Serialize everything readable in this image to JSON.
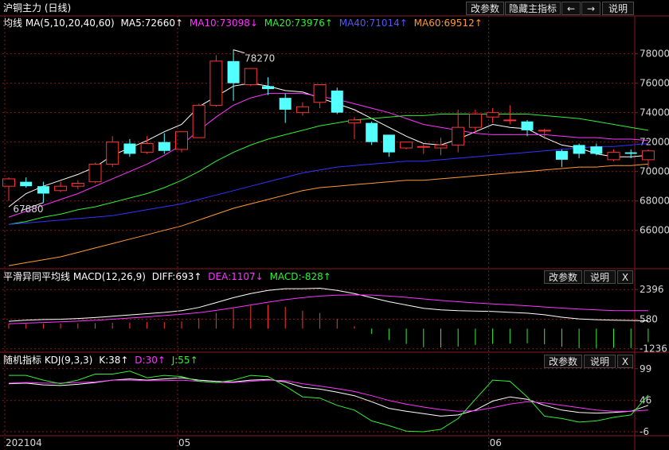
{
  "header": {
    "title": "沪铜主力 (日线)",
    "buttons": [
      "改参数",
      "隐藏主指标",
      "←",
      "→",
      "说明"
    ]
  },
  "main_legend": {
    "ma_title": "均线 MA(5,10,20,40,60)",
    "ma5": "MA5:72660↑",
    "ma10": "MA10:73098↓",
    "ma20": "MA20:73976↑",
    "ma40": "MA40:71014↑",
    "ma60": "MA60:69512↑"
  },
  "macd_panel": {
    "title": "平滑异同平均线 MACD(12,26,9)",
    "diff": "DIFF:693↑",
    "dea": "DEA:1107↓",
    "macd": "MACD:-828↑",
    "buttons": [
      "改参数",
      "说明",
      "X"
    ]
  },
  "kdj_panel": {
    "title": "随机指标 KDJ(9,3,3)",
    "k": "K:38↑",
    "d": "D:30↑",
    "j": "J:55↑",
    "buttons": [
      "改参数",
      "说明",
      "X"
    ]
  },
  "colors": {
    "up": "#ff3232",
    "down": "#54ffff",
    "ma5": "#ffffff",
    "ma10": "#ff33ff",
    "ma20": "#33ee33",
    "ma40": "#3333ff",
    "ma60": "#ff9933"
  },
  "chart_data": [
    {
      "type": "candlestick",
      "title": "沪铜主力 (日线)",
      "y_ticks": [
        66000,
        68000,
        70000,
        72000,
        74000,
        76000,
        78000
      ],
      "ylim": [
        63500,
        79600
      ],
      "x_labels": [
        "202104",
        "05",
        "06"
      ],
      "annotations": {
        "high": "78270",
        "low": "67880"
      },
      "candles": [
        {
          "o": 69000,
          "h": 69600,
          "l": 68000,
          "c": 69500
        },
        {
          "o": 69300,
          "h": 69600,
          "l": 68900,
          "c": 69000
        },
        {
          "o": 69000,
          "h": 69300,
          "l": 67880,
          "c": 68500
        },
        {
          "o": 68700,
          "h": 69300,
          "l": 68600,
          "c": 69000
        },
        {
          "o": 69000,
          "h": 69400,
          "l": 68800,
          "c": 69200
        },
        {
          "o": 69300,
          "h": 70600,
          "l": 69200,
          "c": 70500
        },
        {
          "o": 70500,
          "h": 72400,
          "l": 70300,
          "c": 72000
        },
        {
          "o": 71900,
          "h": 72200,
          "l": 71000,
          "c": 71200
        },
        {
          "o": 71300,
          "h": 72400,
          "l": 71200,
          "c": 71900
        },
        {
          "o": 72000,
          "h": 72600,
          "l": 71200,
          "c": 71400
        },
        {
          "o": 71500,
          "h": 72700,
          "l": 71300,
          "c": 72700
        },
        {
          "o": 72300,
          "h": 74600,
          "l": 72300,
          "c": 74500
        },
        {
          "o": 74500,
          "h": 77900,
          "l": 74400,
          "c": 77500
        },
        {
          "o": 77500,
          "h": 78270,
          "l": 74800,
          "c": 76000
        },
        {
          "o": 75900,
          "h": 77000,
          "l": 75800,
          "c": 77000
        },
        {
          "o": 75800,
          "h": 76400,
          "l": 75200,
          "c": 75600
        },
        {
          "o": 75000,
          "h": 75300,
          "l": 73300,
          "c": 74200
        },
        {
          "o": 74000,
          "h": 74700,
          "l": 73800,
          "c": 74400
        },
        {
          "o": 74700,
          "h": 75900,
          "l": 74300,
          "c": 75900
        },
        {
          "o": 75500,
          "h": 75700,
          "l": 73900,
          "c": 74000
        },
        {
          "o": 73300,
          "h": 73700,
          "l": 72200,
          "c": 73500
        },
        {
          "o": 73300,
          "h": 73400,
          "l": 71800,
          "c": 72000
        },
        {
          "o": 72500,
          "h": 72500,
          "l": 71000,
          "c": 71300
        },
        {
          "o": 71600,
          "h": 71900,
          "l": 71500,
          "c": 72000
        },
        {
          "o": 71700,
          "h": 71900,
          "l": 71200,
          "c": 71700
        },
        {
          "o": 71600,
          "h": 72300,
          "l": 71100,
          "c": 71800
        },
        {
          "o": 71800,
          "h": 74200,
          "l": 71300,
          "c": 73000
        },
        {
          "o": 73000,
          "h": 74200,
          "l": 72600,
          "c": 73900
        },
        {
          "o": 73700,
          "h": 74300,
          "l": 73300,
          "c": 74000
        },
        {
          "o": 73500,
          "h": 74500,
          "l": 73200,
          "c": 73500
        },
        {
          "o": 73400,
          "h": 73500,
          "l": 72400,
          "c": 72800
        },
        {
          "o": 72800,
          "h": 72900,
          "l": 72200,
          "c": 72800
        },
        {
          "o": 71400,
          "h": 71500,
          "l": 70300,
          "c": 70800
        },
        {
          "o": 71800,
          "h": 71900,
          "l": 70900,
          "c": 71200
        },
        {
          "o": 71700,
          "h": 71900,
          "l": 71100,
          "c": 71200
        },
        {
          "o": 70800,
          "h": 71500,
          "l": 70700,
          "c": 71300
        },
        {
          "o": 71300,
          "h": 71500,
          "l": 70900,
          "c": 71200
        },
        {
          "o": 70800,
          "h": 71500,
          "l": 70300,
          "c": 71400
        }
      ],
      "ma_series": [
        {
          "name": "MA5",
          "values": [
            67600,
            68500,
            69000,
            69400,
            69800,
            70300,
            71100,
            71600,
            72100,
            72700,
            73200,
            74400,
            75100,
            75800,
            76000,
            75800,
            75500,
            75400,
            75000,
            74600,
            74200,
            73600,
            73000,
            72400,
            71900,
            71800,
            72200,
            72700,
            73200,
            73000,
            72900,
            72300,
            71800,
            71600,
            71200,
            71000,
            71000,
            71100
          ]
        },
        {
          "name": "MA10",
          "values": [
            66900,
            67300,
            67700,
            68100,
            68500,
            69000,
            69500,
            70000,
            70500,
            71100,
            71800,
            72800,
            73700,
            74500,
            75000,
            75300,
            75300,
            75300,
            75100,
            74900,
            74600,
            74300,
            74000,
            73600,
            73200,
            73000,
            72800,
            72600,
            72500,
            72500,
            72500,
            72500,
            72400,
            72300,
            72300,
            72200,
            72200,
            72100
          ]
        },
        {
          "name": "MA20",
          "values": [
            66400,
            66600,
            66900,
            67100,
            67400,
            67600,
            67900,
            68200,
            68500,
            68900,
            69400,
            70000,
            70700,
            71300,
            71800,
            72200,
            72500,
            72800,
            73100,
            73300,
            73500,
            73600,
            73700,
            73800,
            73800,
            73900,
            73900,
            73900,
            73900,
            73900,
            73900,
            73800,
            73700,
            73600,
            73400,
            73200,
            73000,
            72800
          ]
        },
        {
          "name": "MA40",
          "values": [
            66400,
            66500,
            66600,
            66700,
            66800,
            66900,
            67000,
            67200,
            67400,
            67600,
            67800,
            68100,
            68400,
            68700,
            69000,
            69300,
            69600,
            69900,
            70100,
            70300,
            70400,
            70500,
            70600,
            70700,
            70700,
            70800,
            70900,
            71000,
            71100,
            71200,
            71300,
            71400,
            71500,
            71600,
            71700,
            71700,
            71800,
            71900
          ]
        },
        {
          "name": "MA60",
          "values": [
            63600,
            63800,
            64000,
            64200,
            64500,
            64800,
            65100,
            65400,
            65700,
            66000,
            66300,
            66700,
            67100,
            67500,
            67800,
            68100,
            68400,
            68700,
            68900,
            69000,
            69100,
            69200,
            69300,
            69400,
            69400,
            69500,
            69600,
            69700,
            69800,
            69900,
            70000,
            70100,
            70200,
            70300,
            70300,
            70400,
            70400,
            70500
          ]
        }
      ]
    },
    {
      "type": "macd",
      "title": "平滑异同平均线 MACD(12,26,9)",
      "y_ticks": [
        2396,
        580,
        -1236
      ],
      "ylim": [
        -1300,
        2700
      ],
      "series": [
        {
          "name": "DIFF",
          "values": [
            450,
            520,
            560,
            580,
            620,
            680,
            760,
            840,
            920,
            1000,
            1100,
            1300,
            1600,
            1900,
            2150,
            2350,
            2450,
            2450,
            2480,
            2350,
            2150,
            1900,
            1650,
            1450,
            1250,
            1150,
            1100,
            1080,
            1050,
            1000,
            950,
            850,
            700,
            600,
            550,
            520,
            500,
            480
          ]
        },
        {
          "name": "DEA",
          "values": [
            300,
            340,
            380,
            420,
            460,
            510,
            580,
            650,
            720,
            800,
            880,
            980,
            1120,
            1280,
            1450,
            1620,
            1780,
            1900,
            2000,
            2050,
            2070,
            2060,
            2000,
            1920,
            1820,
            1730,
            1650,
            1580,
            1520,
            1460,
            1400,
            1330,
            1260,
            1200,
            1150,
            1110,
            1100,
            1107
          ]
        },
        {
          "name": "MACD",
          "values": [
            300,
            300,
            300,
            320,
            320,
            340,
            360,
            380,
            400,
            400,
            440,
            640,
            960,
            1240,
            1400,
            1460,
            1340,
            1100,
            960,
            600,
            160,
            -320,
            -700,
            -940,
            -1140,
            -1160,
            -1100,
            -1000,
            -940,
            -920,
            -900,
            -960,
            -1120,
            -1200,
            -1200,
            -1180,
            -1200,
            -828
          ]
        }
      ]
    },
    {
      "type": "kdj",
      "title": "随机指标 KDJ(9,3,3)",
      "y_ticks": [
        99,
        46,
        -6
      ],
      "ylim": [
        -10,
        100
      ],
      "series": [
        {
          "name": "K",
          "values": [
            74,
            75,
            72,
            71,
            73,
            76,
            80,
            82,
            80,
            82,
            84,
            80,
            78,
            77,
            80,
            81,
            77,
            68,
            65,
            60,
            54,
            44,
            33,
            28,
            24,
            20,
            22,
            30,
            45,
            52,
            48,
            38,
            30,
            26,
            25,
            26,
            28,
            38
          ]
        },
        {
          "name": "D",
          "values": [
            75,
            76,
            75,
            75,
            76,
            77,
            80,
            80,
            79,
            79,
            80,
            78,
            76,
            76,
            78,
            80,
            79,
            74,
            70,
            66,
            61,
            54,
            46,
            40,
            35,
            31,
            28,
            29,
            34,
            40,
            44,
            42,
            38,
            34,
            30,
            28,
            28,
            30
          ]
        },
        {
          "name": "J",
          "values": [
            88,
            88,
            80,
            74,
            80,
            90,
            90,
            95,
            84,
            88,
            86,
            78,
            76,
            80,
            88,
            86,
            70,
            52,
            50,
            38,
            30,
            12,
            4,
            -5,
            -6,
            -2,
            16,
            48,
            80,
            78,
            52,
            20,
            16,
            10,
            12,
            18,
            22,
            55
          ]
        }
      ]
    }
  ]
}
